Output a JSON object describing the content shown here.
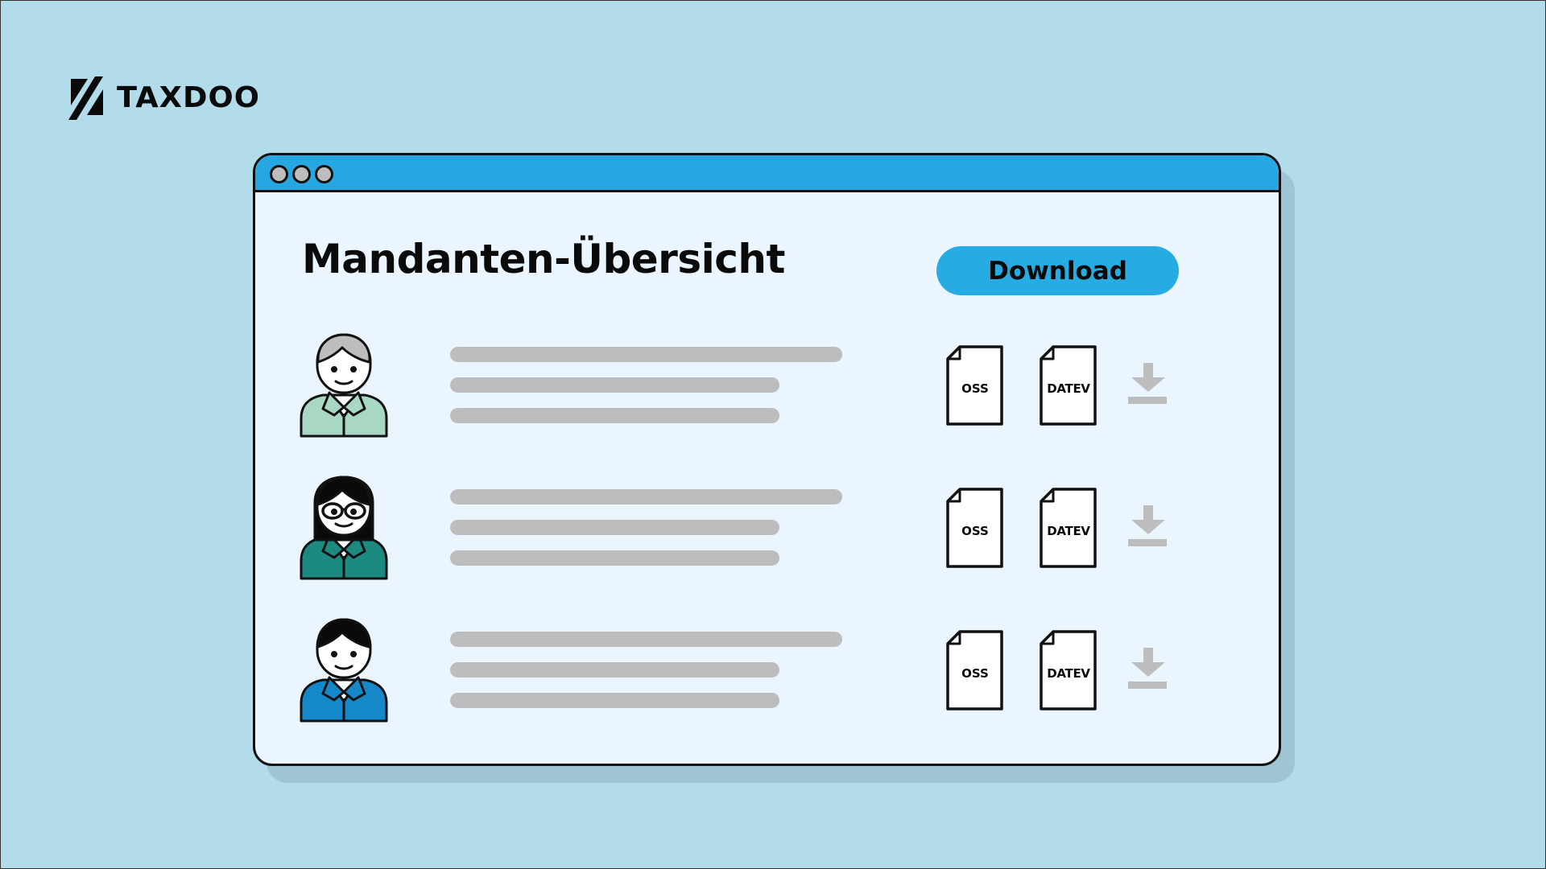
{
  "brand": {
    "name": "TAXDOO",
    "icon": "taxdoo-logo-mark"
  },
  "window": {
    "controls": [
      "close-dot",
      "minimize-dot",
      "maximize-dot"
    ],
    "title": "Mandanten-Übersicht",
    "download_button_label": "Download"
  },
  "clients": [
    {
      "avatar": "person-gray-hair-icon",
      "hair_color": "#bdbdbd",
      "shirt_color": "#a8d8c4",
      "glasses": false,
      "files": [
        {
          "label": "OSS",
          "icon": "document-icon"
        },
        {
          "label": "DATEV",
          "icon": "document-icon"
        }
      ],
      "download_icon": "download-icon"
    },
    {
      "avatar": "person-long-hair-glasses-icon",
      "hair_color": "#0a0a0a",
      "shirt_color": "#1d8a82",
      "glasses": true,
      "files": [
        {
          "label": "OSS",
          "icon": "document-icon"
        },
        {
          "label": "DATEV",
          "icon": "document-icon"
        }
      ],
      "download_icon": "download-icon"
    },
    {
      "avatar": "person-black-hair-icon",
      "hair_color": "#0a0a0a",
      "shirt_color": "#1488c8",
      "glasses": false,
      "files": [
        {
          "label": "OSS",
          "icon": "document-icon"
        },
        {
          "label": "DATEV",
          "icon": "document-icon"
        }
      ],
      "download_icon": "download-icon"
    }
  ],
  "colors": {
    "background": "#b3dcea",
    "titlebar": "#27a7e1",
    "button": "#27abe3",
    "window_body": "#eaf5ff",
    "placeholder_bar": "#bdbdbd",
    "download_icon": "#bdbdbd"
  }
}
